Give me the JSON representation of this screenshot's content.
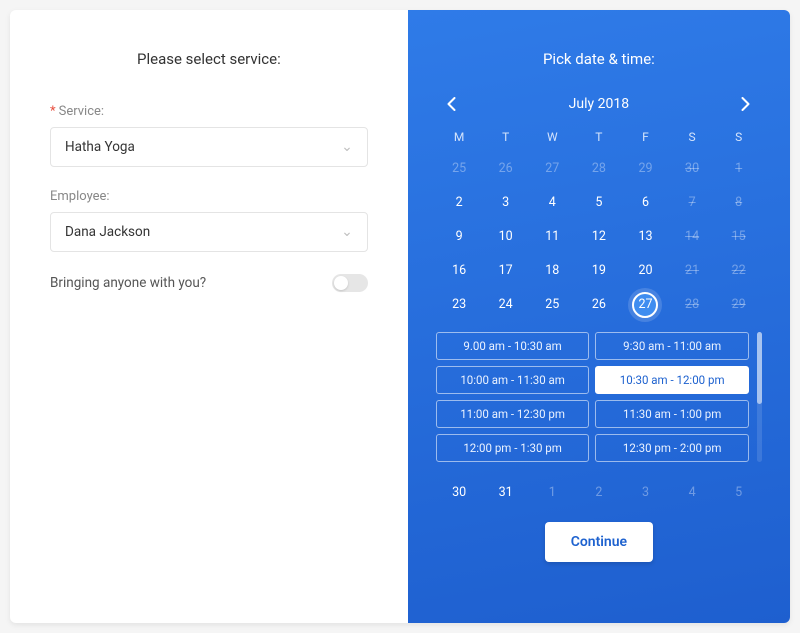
{
  "left": {
    "heading": "Please select service:",
    "service": {
      "label": "Service:",
      "value": "Hatha Yoga",
      "required": true
    },
    "employee": {
      "label": "Employee:",
      "value": "Dana Jackson",
      "required": false
    },
    "bringing": {
      "label": "Bringing anyone with you?",
      "value": false
    }
  },
  "right": {
    "heading": "Pick date & time:",
    "month_label": "July 2018",
    "dow": [
      "M",
      "T",
      "W",
      "T",
      "F",
      "S",
      "S"
    ],
    "days": [
      {
        "n": "25",
        "state": "muted"
      },
      {
        "n": "26",
        "state": "muted"
      },
      {
        "n": "27",
        "state": "muted"
      },
      {
        "n": "28",
        "state": "muted"
      },
      {
        "n": "29",
        "state": "muted"
      },
      {
        "n": "30",
        "state": "strike"
      },
      {
        "n": "1",
        "state": "strike"
      },
      {
        "n": "2",
        "state": "normal"
      },
      {
        "n": "3",
        "state": "normal"
      },
      {
        "n": "4",
        "state": "normal"
      },
      {
        "n": "5",
        "state": "normal"
      },
      {
        "n": "6",
        "state": "normal"
      },
      {
        "n": "7",
        "state": "strike"
      },
      {
        "n": "8",
        "state": "strike"
      },
      {
        "n": "9",
        "state": "normal"
      },
      {
        "n": "10",
        "state": "normal"
      },
      {
        "n": "11",
        "state": "normal"
      },
      {
        "n": "12",
        "state": "normal"
      },
      {
        "n": "13",
        "state": "normal"
      },
      {
        "n": "14",
        "state": "strike"
      },
      {
        "n": "15",
        "state": "strike"
      },
      {
        "n": "16",
        "state": "normal"
      },
      {
        "n": "17",
        "state": "normal"
      },
      {
        "n": "18",
        "state": "normal"
      },
      {
        "n": "19",
        "state": "normal"
      },
      {
        "n": "20",
        "state": "normal"
      },
      {
        "n": "21",
        "state": "strike"
      },
      {
        "n": "22",
        "state": "strike"
      },
      {
        "n": "23",
        "state": "normal"
      },
      {
        "n": "24",
        "state": "normal"
      },
      {
        "n": "25",
        "state": "normal"
      },
      {
        "n": "26",
        "state": "normal"
      },
      {
        "n": "27",
        "state": "selected"
      },
      {
        "n": "28",
        "state": "strike"
      },
      {
        "n": "29",
        "state": "strike"
      },
      {
        "n": "30",
        "state": "normal"
      },
      {
        "n": "31",
        "state": "normal"
      },
      {
        "n": "1",
        "state": "muted"
      },
      {
        "n": "2",
        "state": "muted"
      },
      {
        "n": "3",
        "state": "muted"
      },
      {
        "n": "4",
        "state": "muted"
      },
      {
        "n": "5",
        "state": "muted"
      }
    ],
    "slots": [
      {
        "label": "9.00 am - 10:30 am",
        "selected": false
      },
      {
        "label": "9:30 am - 11:00 am",
        "selected": false
      },
      {
        "label": "10:00 am - 11:30 am",
        "selected": false
      },
      {
        "label": "10:30 am - 12:00 pm",
        "selected": true
      },
      {
        "label": "11:00 am - 12:30 pm",
        "selected": false
      },
      {
        "label": "11:30 am - 1:00 pm",
        "selected": false
      },
      {
        "label": "12:00 pm - 1:30 pm",
        "selected": false
      },
      {
        "label": "12:30 pm - 2:00 pm",
        "selected": false
      }
    ],
    "continue_label": "Continue"
  }
}
